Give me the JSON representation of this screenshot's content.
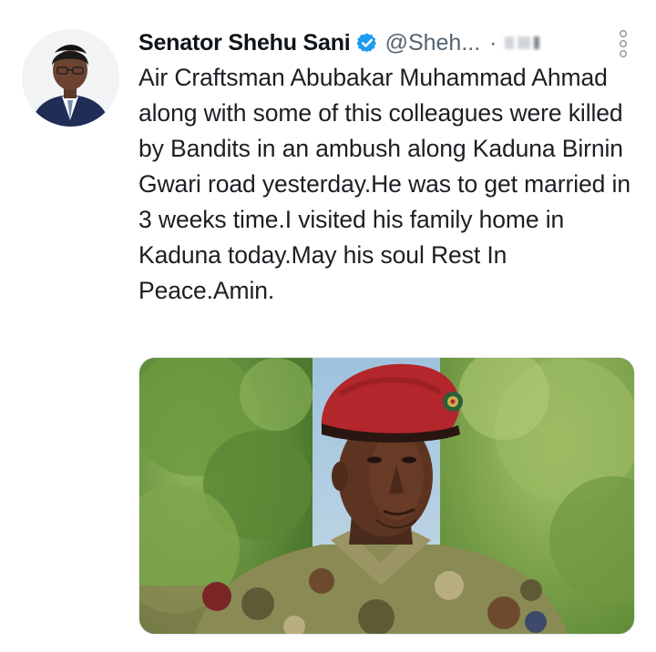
{
  "author": {
    "display_name": "Senator Shehu Sani",
    "handle": "@Sheh...",
    "separator": "·",
    "verified_icon": "verified-badge-icon",
    "avatar_icon": "avatar-portrait",
    "more_icon": "more-vertical-icon"
  },
  "tweet": {
    "text": "Air Craftsman Abubakar Muhammad Ahmad along with some of this colleagues were killed by Bandits in an ambush along Kaduna Birnin Gwari road yesterday.He was to get married in 3 weeks time.I visited his family home in Kaduna today.May his soul Rest In Peace.Amin."
  },
  "colors": {
    "verified": "#1d9bf0",
    "muted": "#536471",
    "text": "#0f1419",
    "beret": "#b3262c"
  }
}
